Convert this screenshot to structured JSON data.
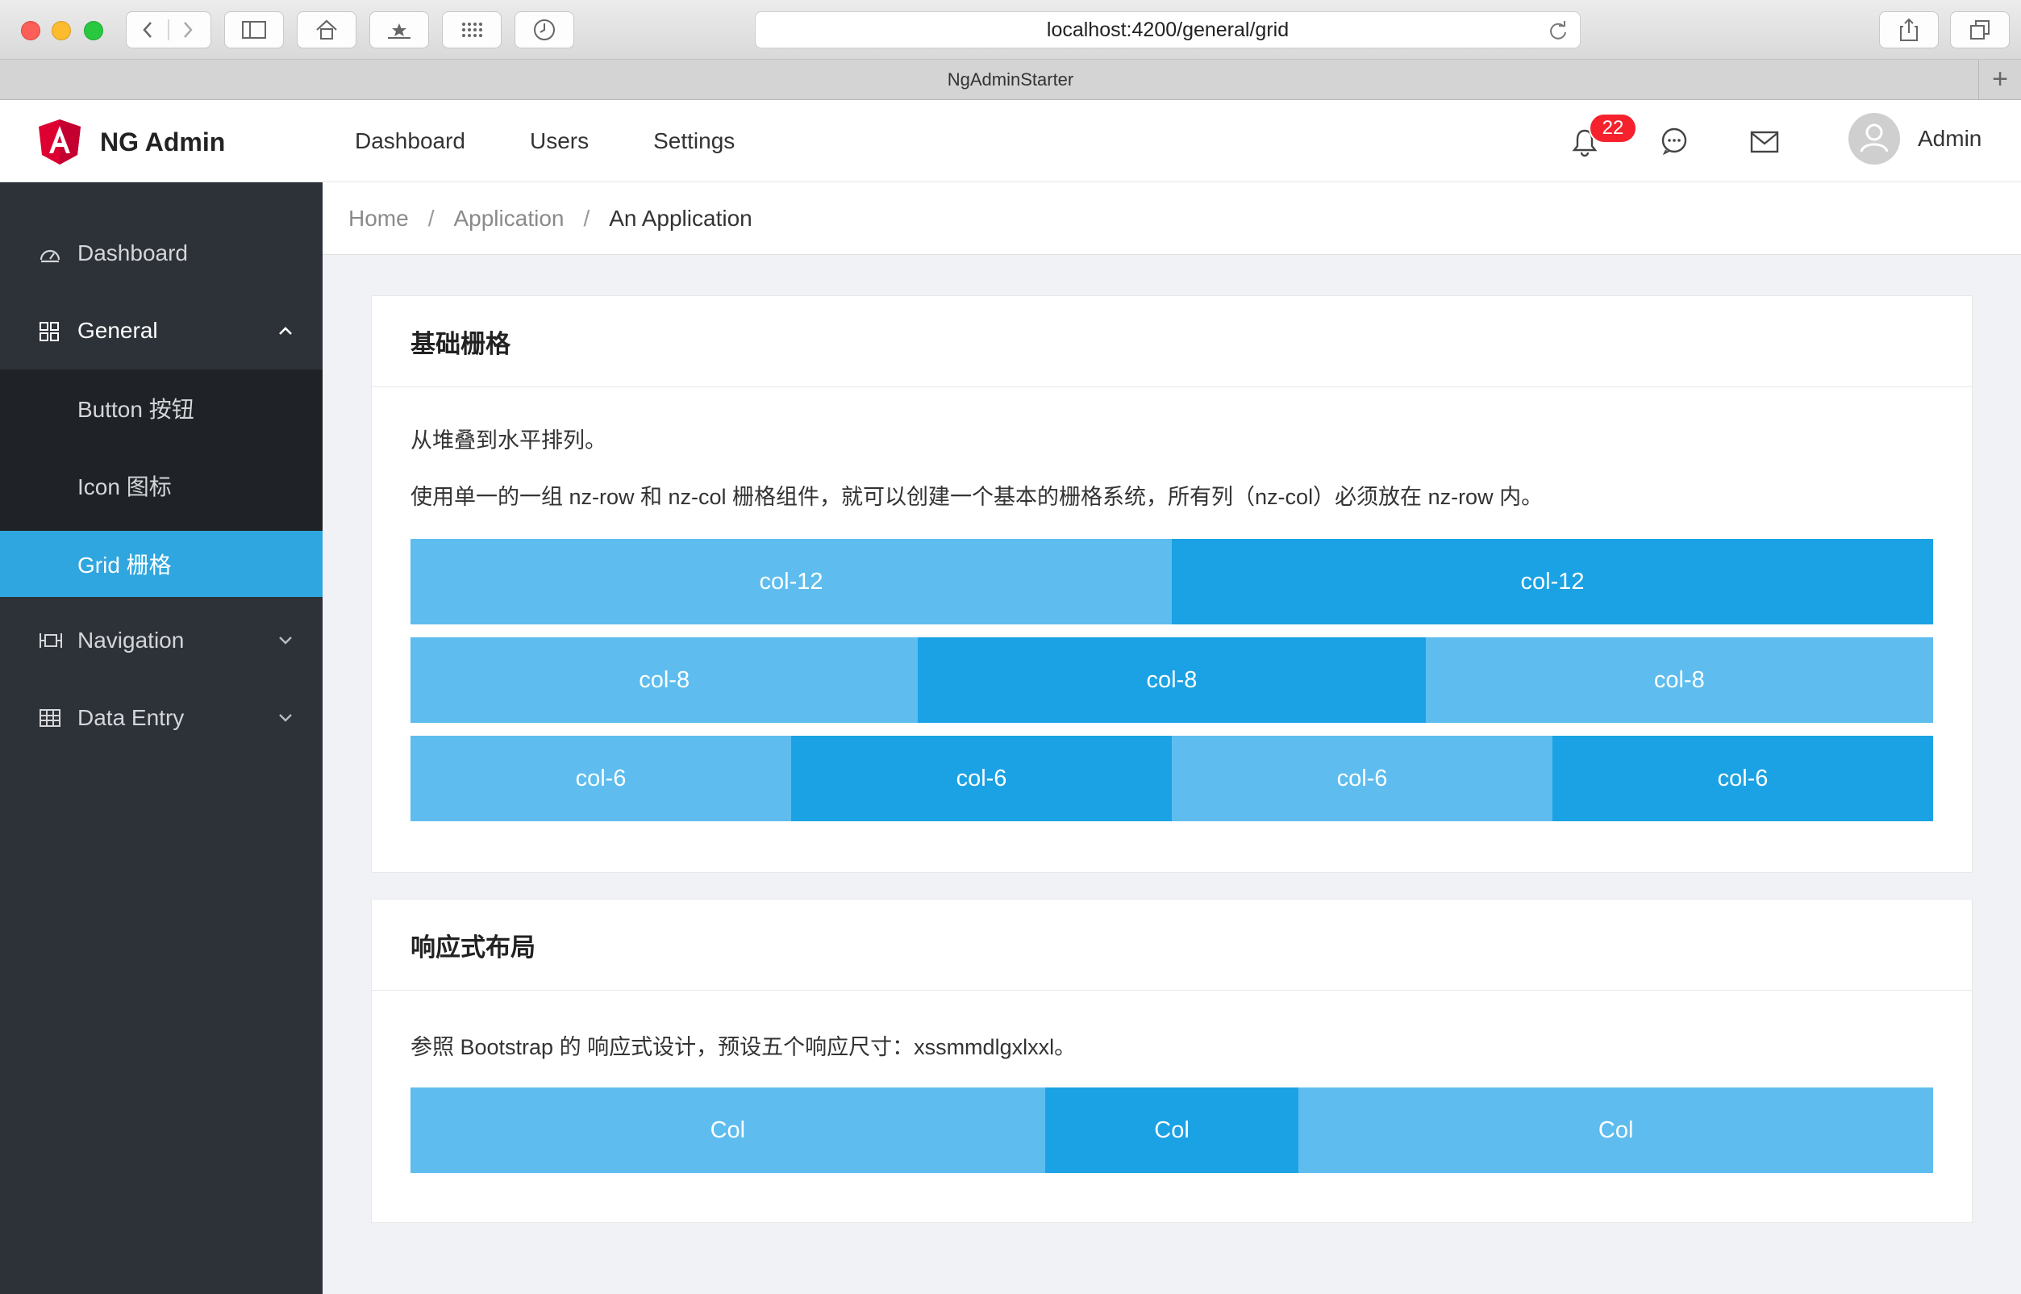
{
  "browser": {
    "url": "localhost:4200/general/grid",
    "tab_title": "NgAdminStarter"
  },
  "header": {
    "logo_text": "NG Admin",
    "nav": [
      "Dashboard",
      "Users",
      "Settings"
    ],
    "notification_count": "22",
    "user_name": "Admin"
  },
  "sidebar": {
    "items": [
      {
        "label": "Dashboard",
        "icon": "dashboard-icon"
      },
      {
        "label": "General",
        "icon": "appstore-icon",
        "expanded": true
      },
      {
        "label": "Button 按钮",
        "sub": true
      },
      {
        "label": "Icon 图标",
        "sub": true
      },
      {
        "label": "Grid 栅格",
        "sub": true,
        "active": true
      },
      {
        "label": "Navigation",
        "icon": "navigation-icon"
      },
      {
        "label": "Data Entry",
        "icon": "table-icon"
      }
    ]
  },
  "breadcrumb": {
    "items": [
      "Home",
      "Application",
      "An Application"
    ]
  },
  "card_basic": {
    "title": "基础栅格",
    "desc1": "从堆叠到水平排列。",
    "desc2": "使用单一的一组 nz-row 和 nz-col 栅格组件，就可以创建一个基本的栅格系统，所有列（nz-col）必须放在 nz-row 内。",
    "rows": [
      [
        "col-12",
        "col-12"
      ],
      [
        "col-8",
        "col-8",
        "col-8"
      ],
      [
        "col-6",
        "col-6",
        "col-6",
        "col-6"
      ]
    ]
  },
  "card_responsive": {
    "title": "响应式布局",
    "desc": "参照 Bootstrap 的 响应式设计，预设五个响应尺寸：xssmmdlgxlxxl。",
    "cols": [
      "Col",
      "Col",
      "Col"
    ]
  },
  "colors": {
    "sidebar_bg": "#2d3138",
    "active": "#2fa6df",
    "col_light": "#5ebdee",
    "col_dark": "#1ba2e4",
    "badge": "#f5222d"
  }
}
